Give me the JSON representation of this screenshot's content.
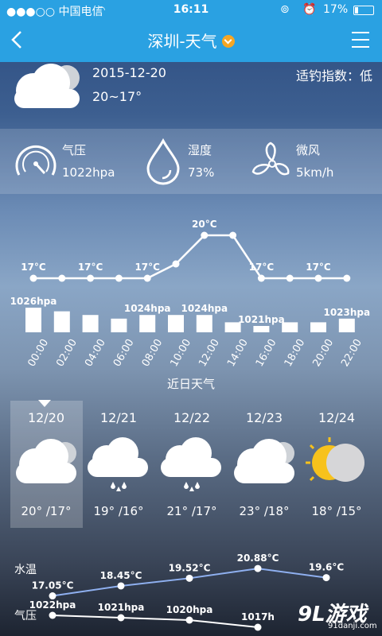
{
  "status_bar": {
    "carrier": "●●●○○ 中国电信",
    "time": "16:11",
    "battery": "17%"
  },
  "nav": {
    "title": "深圳-天气",
    "back_icon": "chevron-left-icon",
    "menu_icon": "hamburger-menu-icon"
  },
  "today": {
    "date": "2015-12-20",
    "temp_range": "20~17°",
    "fishing_index": "适钓指数：低",
    "weather_icon": "cloudy-icon"
  },
  "stats": [
    {
      "label": "气压",
      "value": "1022hpa",
      "icon": "gauge-icon"
    },
    {
      "label": "湿度",
      "value": "73%",
      "icon": "water-drop-icon"
    },
    {
      "label": "微风",
      "value": "5km/h",
      "icon": "fan-icon"
    }
  ],
  "chart_data": {
    "type": "line",
    "x": [
      "00:00",
      "02:00",
      "04:00",
      "06:00",
      "08:00",
      "10:00",
      "12:00",
      "14:00",
      "16:00",
      "18:00",
      "20:00",
      "22:00"
    ],
    "series": [
      {
        "values": [
          17,
          17,
          17,
          17,
          17,
          18,
          20,
          20,
          17,
          17,
          17,
          17
        ]
      },
      {
        "values": [
          1026,
          1025,
          1024,
          1023,
          1024,
          1024,
          1024,
          1022,
          1021,
          1022,
          1022,
          1023
        ]
      }
    ],
    "temp_labels": [
      {
        "i": 0,
        "text": "17°C"
      },
      {
        "i": 2,
        "text": "17°C"
      },
      {
        "i": 4,
        "text": "17°C"
      },
      {
        "i": 6,
        "text": "20°C"
      },
      {
        "i": 8,
        "text": "17°C"
      },
      {
        "i": 10,
        "text": "17°C"
      }
    ],
    "pressure_labels": [
      {
        "i": 0,
        "text": "1026hpa"
      },
      {
        "i": 4,
        "text": "1024hpa"
      },
      {
        "i": 6,
        "text": "1024hpa"
      },
      {
        "i": 8,
        "text": "1021hpa"
      },
      {
        "i": 11,
        "text": "1023hpa"
      }
    ]
  },
  "forecast": {
    "title": "近日天气",
    "days": [
      {
        "date": "12/20",
        "temp": "20° /17°",
        "icon": "cloudy-icon"
      },
      {
        "date": "12/21",
        "temp": "19° /16°",
        "icon": "rain-icon"
      },
      {
        "date": "12/22",
        "temp": "21° /17°",
        "icon": "rain-icon"
      },
      {
        "date": "12/23",
        "temp": "23° /18°",
        "icon": "cloudy-icon"
      },
      {
        "date": "12/24",
        "temp": "18° /15°",
        "icon": "partly-cloudy-icon"
      }
    ]
  },
  "daily_trend": {
    "water_label": "水温",
    "pressure_label": "气压",
    "water_temps": [
      "17.05°C",
      "18.45°C",
      "19.52°C",
      "20.88°C",
      "19.6°C"
    ],
    "water_values": [
      17.05,
      18.45,
      19.52,
      20.88,
      19.6
    ],
    "pressures": [
      "1022hpa",
      "1021hpa",
      "1020hpa",
      "1017h"
    ],
    "pressure_values": [
      1022,
      1021,
      1020,
      1017
    ]
  },
  "watermark": {
    "main": "9L游戏",
    "sub": "91danji.com"
  },
  "colors": {
    "accent": "#2aa1e2",
    "water_line": "#8fb0f0"
  }
}
